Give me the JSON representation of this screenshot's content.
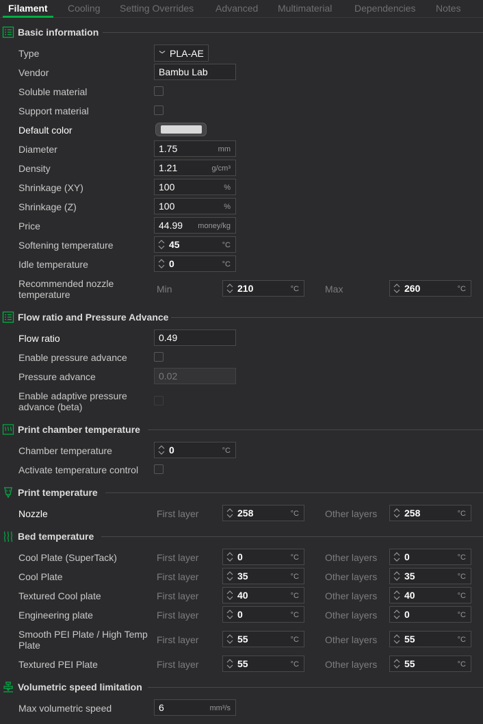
{
  "tabs": [
    {
      "label": "Filament",
      "active": true
    },
    {
      "label": "Cooling"
    },
    {
      "label": "Setting Overrides"
    },
    {
      "label": "Advanced"
    },
    {
      "label": "Multimaterial"
    },
    {
      "label": "Dependencies"
    },
    {
      "label": "Notes"
    }
  ],
  "basic": {
    "title": "Basic information",
    "type_label": "Type",
    "type_value": "PLA-AE",
    "vendor_label": "Vendor",
    "vendor_value": "Bambu Lab",
    "soluble_label": "Soluble material",
    "support_label": "Support material",
    "default_color_label": "Default color",
    "default_color_hex": "#d9d9d9",
    "diameter_label": "Diameter",
    "diameter_value": "1.75",
    "diameter_unit": "mm",
    "density_label": "Density",
    "density_value": "1.21",
    "density_unit": "g/cm³",
    "shrink_xy_label": "Shrinkage (XY)",
    "shrink_xy_value": "100",
    "shrink_z_label": "Shrinkage (Z)",
    "shrink_z_value": "100",
    "percent_unit": "%",
    "price_label": "Price",
    "price_value": "44.99",
    "price_unit": "money/kg",
    "softening_label": "Softening temperature",
    "softening_value": "45",
    "idle_label": "Idle temperature",
    "idle_value": "0",
    "temp_unit": "°C",
    "rec_nozzle_label": "Recommended nozzle temperature",
    "min_label": "Min",
    "min_value": "210",
    "max_label": "Max",
    "max_value": "260"
  },
  "flow": {
    "title": "Flow ratio and Pressure Advance",
    "flow_ratio_label": "Flow ratio",
    "flow_ratio_value": "0.49",
    "enable_pa_label": "Enable pressure advance",
    "pa_label": "Pressure advance",
    "pa_value": "0.02",
    "adaptive_label": "Enable adaptive pressure advance (beta)"
  },
  "chamber": {
    "title": "Print chamber temperature",
    "temp_label": "Chamber temperature",
    "temp_value": "0",
    "activate_label": "Activate temperature control"
  },
  "print_temp": {
    "title": "Print temperature",
    "nozzle_label": "Nozzle",
    "first_layer_label": "First layer",
    "first_layer_value": "258",
    "other_layers_label": "Other layers",
    "other_layers_value": "258"
  },
  "bed": {
    "title": "Bed temperature",
    "first_layer_label": "First layer",
    "other_layers_label": "Other layers",
    "plates": [
      {
        "name": "Cool Plate (SuperTack)",
        "first": "0",
        "other": "0"
      },
      {
        "name": "Cool Plate",
        "first": "35",
        "other": "35"
      },
      {
        "name": "Textured Cool plate",
        "first": "40",
        "other": "40"
      },
      {
        "name": "Engineering plate",
        "first": "0",
        "other": "0"
      },
      {
        "name": "Smooth PEI Plate / High Temp Plate",
        "first": "55",
        "other": "55"
      },
      {
        "name": "Textured PEI Plate",
        "first": "55",
        "other": "55"
      }
    ]
  },
  "volumetric": {
    "title": "Volumetric speed limitation",
    "max_label": "Max volumetric speed",
    "max_value": "6",
    "unit": "mm³/s"
  },
  "colors": {
    "accent": "#00ae42",
    "background": "#2b2b2d"
  }
}
